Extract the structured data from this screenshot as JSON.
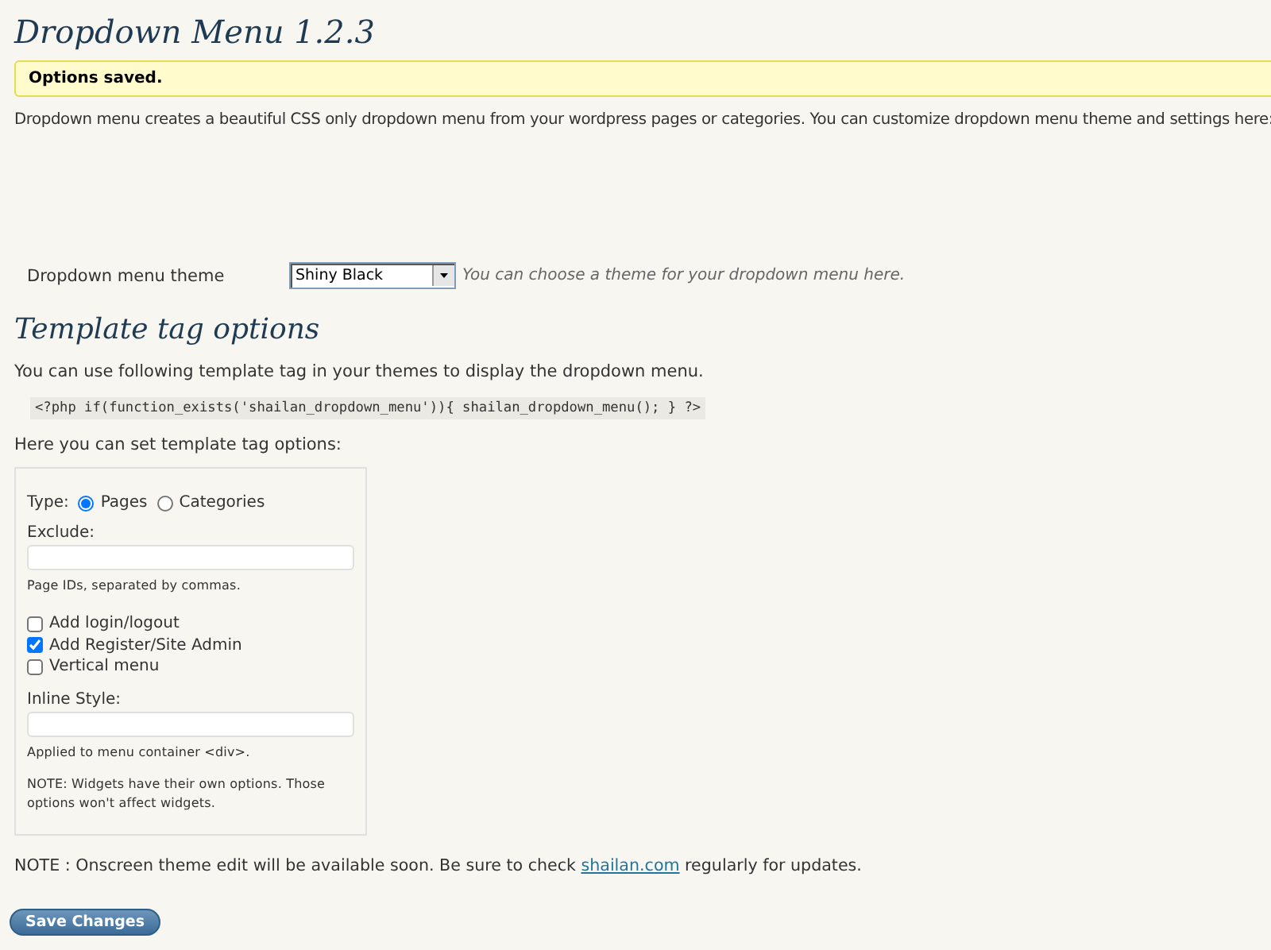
{
  "title": "Dropdown Menu 1.2.3",
  "notice": "Options saved.",
  "intro": "Dropdown menu creates a beautiful CSS only dropdown menu from your wordpress pages or categories. You can customize dropdown menu theme and settings here:",
  "theme": {
    "label": "Dropdown menu theme",
    "value": "Shiny Black",
    "hint": "You can choose a theme for your dropdown menu here."
  },
  "template_heading": "Template tag options",
  "template_intro": "You can use following template tag in your themes to display the dropdown menu.",
  "code": "<?php if(function_exists('shailan_dropdown_menu')){ shailan_dropdown_menu(); } ?>",
  "options_intro": "Here you can set template tag options:",
  "options": {
    "type_label": "Type:",
    "type_options": [
      {
        "label": "Pages",
        "selected": true
      },
      {
        "label": "Categories",
        "selected": false
      }
    ],
    "exclude": {
      "label": "Exclude:",
      "hint": "Page IDs, separated by commas."
    },
    "checkboxes": [
      {
        "label": "Add login/logout",
        "checked": false
      },
      {
        "label": "Add Register/Site Admin",
        "checked": true
      },
      {
        "label": "Vertical menu",
        "checked": false
      }
    ],
    "inline_style": {
      "label": "Inline Style:",
      "hint": "Applied to menu container <div>."
    },
    "note": "NOTE: Widgets have their own options. Those options won't affect widgets."
  },
  "footer_note": {
    "before": "NOTE : Onscreen theme edit will be available soon. Be sure to check ",
    "link": "shailan.com",
    "after": " regularly for updates."
  },
  "save_button": "Save Changes"
}
